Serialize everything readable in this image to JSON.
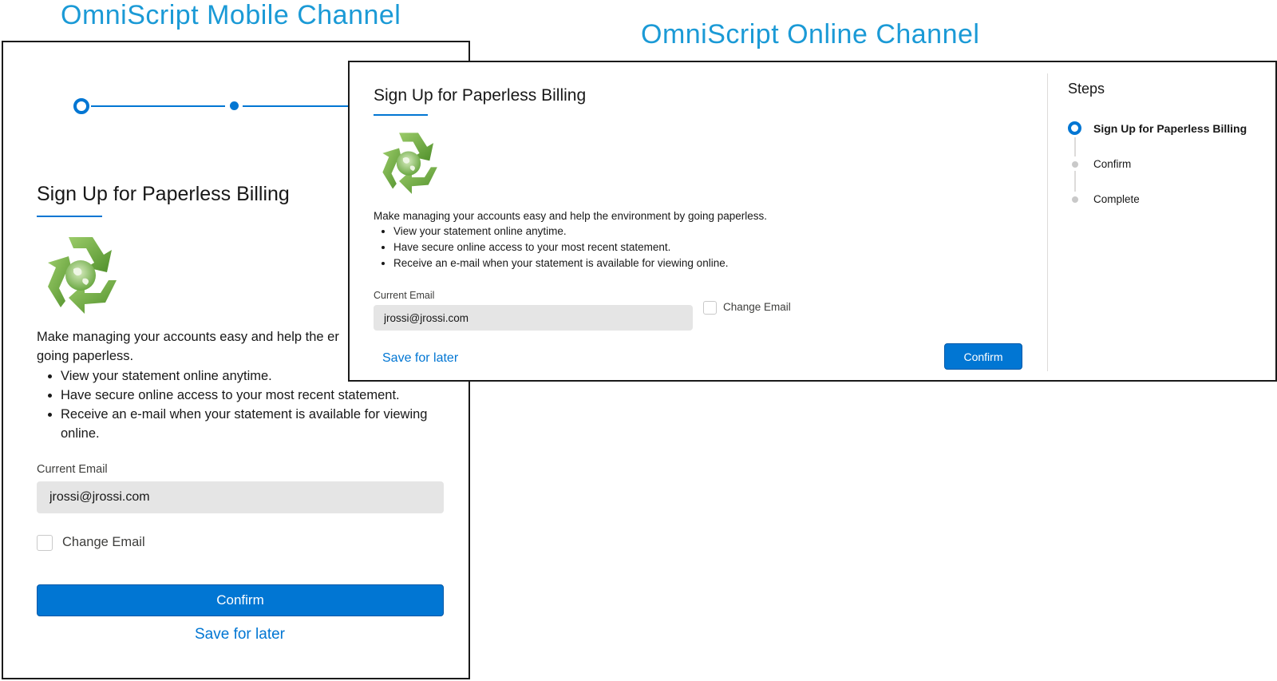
{
  "labels": {
    "mobile": "OmniScript  Mobile Channel",
    "online": "OmniScript Online Channel"
  },
  "form": {
    "title": "Sign Up for Paperless Billing",
    "intro_mobile_line1": "Make managing your accounts easy and help the er",
    "intro_mobile_line2": "going paperless.",
    "intro_online": "Make managing your accounts easy and help the environment by going paperless.",
    "bullets": [
      "View your statement online anytime.",
      "Have secure online access to your most recent statement.",
      "Receive an e-mail when your statement is available for viewing online."
    ],
    "email_label": "Current Email",
    "email_value": "jrossi@jrossi.com",
    "change_email_label": "Change Email",
    "change_email_checked": false,
    "confirm_label": "Confirm",
    "save_label": "Save for later"
  },
  "mobile_progress": {
    "current_step": 1,
    "total_visible_steps": 2
  },
  "steps": {
    "title": "Steps",
    "items": [
      {
        "label": "Sign Up for Paperless Billing",
        "active": true
      },
      {
        "label": "Confirm",
        "active": false
      },
      {
        "label": "Complete",
        "active": false
      }
    ]
  },
  "colors": {
    "brand_blue": "#0176d3",
    "label_blue": "#1b9ad6",
    "input_bg": "#e5e5e5",
    "recycle_green": "#6aaa3a"
  },
  "icons": {
    "logo": "recycle-globe-icon"
  }
}
